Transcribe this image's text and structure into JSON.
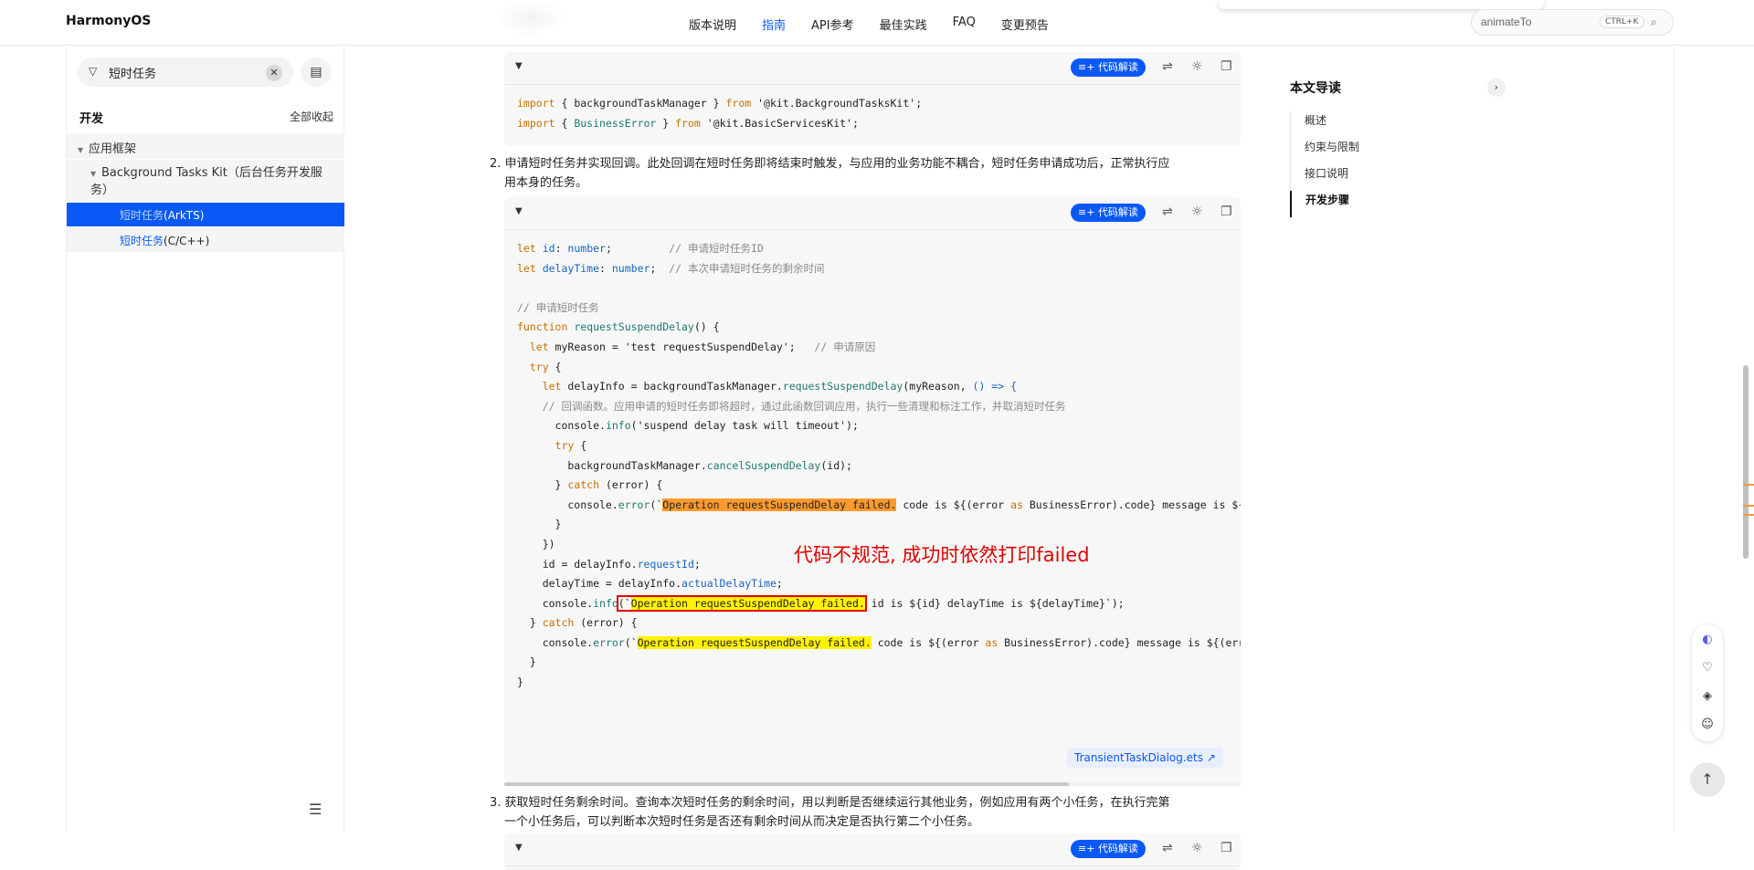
{
  "header": {
    "logo": "HarmonyOS",
    "nav": [
      "版本说明",
      "指南",
      "API参考",
      "最佳实践",
      "FAQ",
      "变更预告"
    ],
    "active_nav": "指南",
    "search_value": "animateTo",
    "search_shortcut": "CTRL+K"
  },
  "sidebar": {
    "filter_text": "短时任务",
    "title": "开发",
    "collapse_all": "全部收起",
    "tree": {
      "l1": "应用框架",
      "l2": "Background Tasks Kit（后台任务开发服务）",
      "l3a_hl": "短时任务",
      "l3a_rest": "(ArkTS)",
      "l3b_hl": "短时任务",
      "l3b_rest": "(C/C++)"
    }
  },
  "main": {
    "explain_label": "代码解读",
    "block1": {
      "lines": [
        "import { backgroundTaskManager } from '@kit.BackgroundTasksKit';",
        "import { BusinessError } from '@kit.BasicServicesKit';"
      ]
    },
    "step2": "2. 申请短时任务并实现回调。此处回调在短时任务即将结束时触发，与应用的业务功能不耦合，短时任务申请成功后，正常执行应用本身的任务。",
    "step2_line1": "2. 申请短时任务并实现回调。此处回调在短时任务即将结束时触发，与应用的业务功能不耦合，短时任务申请成功后，正常执行应",
    "step2_line2": "用本身的任务。",
    "code2": {
      "l1a": "let ",
      "l1b": "id",
      "l1c": ": ",
      "l1d": "number",
      "l1e": ";         ",
      "l1f": "// 申请短时任务ID",
      "l2a": "let ",
      "l2b": "delayTime",
      "l2c": ": ",
      "l2d": "number",
      "l2e": ";  ",
      "l2f": "// 本次申请短时任务的剩余时间",
      "l4": "// 申请短时任务",
      "l5a": "function ",
      "l5b": "requestSuspendDelay",
      "l5c": "() {",
      "l6a": "  let ",
      "l6b": "myReason = 'test requestSuspendDelay';   ",
      "l6c": "// 申请原因",
      "l7a": "  try",
      "l7b": " {",
      "l8a": "    let ",
      "l8b": "delayInfo = backgroundTaskManager.",
      "l8c": "requestSuspendDelay",
      "l8d": "(myReason, ",
      "l8e": "() => {",
      "l9": "    // 回调函数。应用申请的短时任务即将超时，通过此函数回调应用，执行一些清理和标注工作，并取消短时任务",
      "l10a": "      console.",
      "l10b": "info",
      "l10c": "('suspend delay task will timeout');",
      "l11a": "      try",
      "l11b": " {",
      "l12a": "        backgroundTaskManager.",
      "l12b": "cancelSuspendDelay",
      "l12c": "(id);",
      "l13a": "      } ",
      "l13b": "catch",
      "l13c": " (error) {",
      "l14a": "        console.",
      "l14b": "error",
      "l14c": "(`",
      "l14d": "Operation requestSuspendDelay failed.",
      "l14e": " code is ${(error ",
      "l14f": "as",
      "l14g": " BusinessError).code} message is ${",
      "l15": "      }",
      "l16": "    })",
      "l17a": "    id = delayInfo.",
      "l17b": "requestId",
      "l17c": ";",
      "l18a": "    delayTime = delayInfo.",
      "l18b": "actualDelayTime",
      "l18c": ";",
      "l19a": "    console.",
      "l19b": "info",
      "l19c": "(`",
      "l19d": "Operation requestSuspendDelay failed.",
      "l19e": " id is ${id} delayTime is ${delayTime}`);",
      "l20a": "  } ",
      "l20b": "catch",
      "l20c": " (error) {",
      "l21a": "    console.",
      "l21b": "error",
      "l21c": "(`",
      "l21d": "Operation requestSuspendDelay failed.",
      "l21e": " code is ${(error ",
      "l21f": "as",
      "l21g": " BusinessError).code} message is ${(err",
      "l22": "  }",
      "l23": "}"
    },
    "annotation": "代码不规范, 成功时依然打印failed",
    "file_link": "TransientTaskDialog.ets",
    "step3_line1": "3. 获取短时任务剩余时间。查询本次短时任务的剩余时间，用以判断是否继续运行其他业务，例如应用有两个小任务，在执行完第",
    "step3_line2": "一个小任务后，可以判断本次短时任务是否还有剩余时间从而决定是否执行第二个小任务。"
  },
  "toc": {
    "title": "本文导读",
    "items": [
      "概述",
      "约束与限制",
      "接口说明",
      "开发步骤"
    ],
    "active": "开发步骤"
  }
}
